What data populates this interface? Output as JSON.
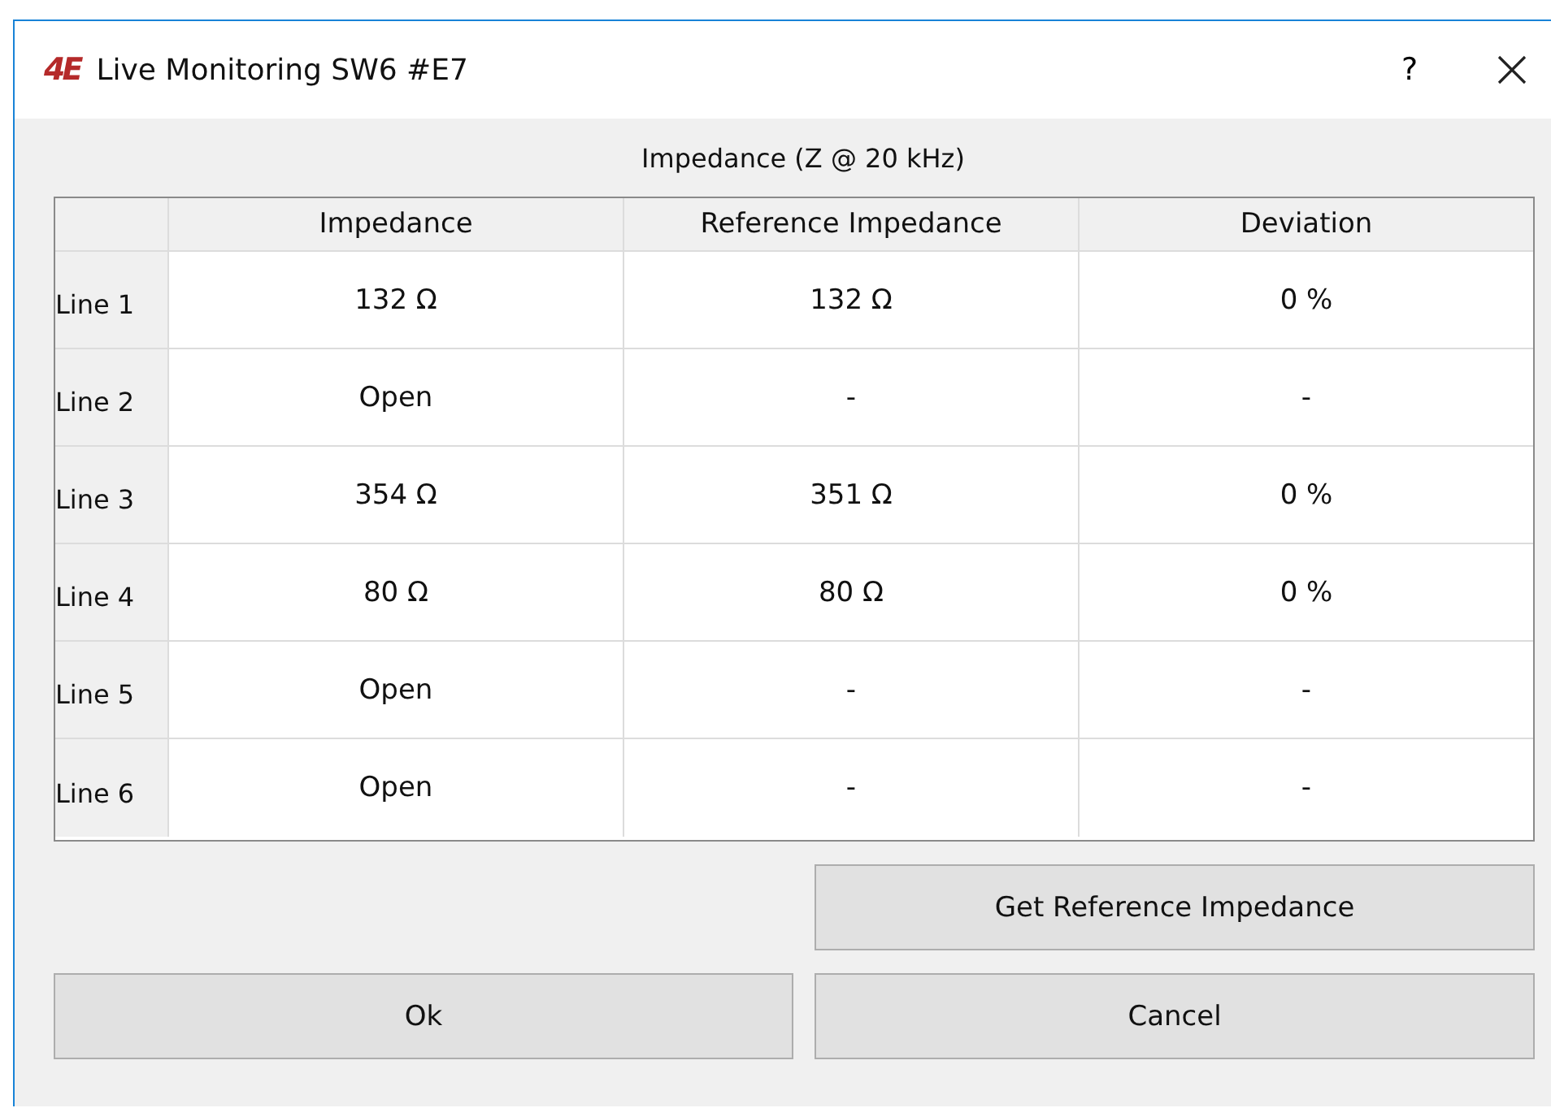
{
  "window": {
    "logo": "4E",
    "title": "Live Monitoring SW6 #E7",
    "help": "?"
  },
  "caption": "Impedance (Z @ 20 kHz)",
  "table": {
    "columns": [
      "Impedance",
      "Reference Impedance",
      "Deviation"
    ],
    "rows": [
      {
        "label": "Line 1",
        "cells": [
          "132 Ω",
          "132 Ω",
          "0 %"
        ]
      },
      {
        "label": "Line 2",
        "cells": [
          "Open",
          "-",
          "-"
        ]
      },
      {
        "label": "Line 3",
        "cells": [
          "354 Ω",
          "351 Ω",
          "0 %"
        ]
      },
      {
        "label": "Line 4",
        "cells": [
          "80 Ω",
          "80 Ω",
          "0 %"
        ]
      },
      {
        "label": "Line 5",
        "cells": [
          "Open",
          "-",
          "-"
        ]
      },
      {
        "label": "Line 6",
        "cells": [
          "Open",
          "-",
          "-"
        ]
      }
    ]
  },
  "buttons": {
    "get_reference": "Get Reference Impedance",
    "ok": "Ok",
    "cancel": "Cancel"
  }
}
